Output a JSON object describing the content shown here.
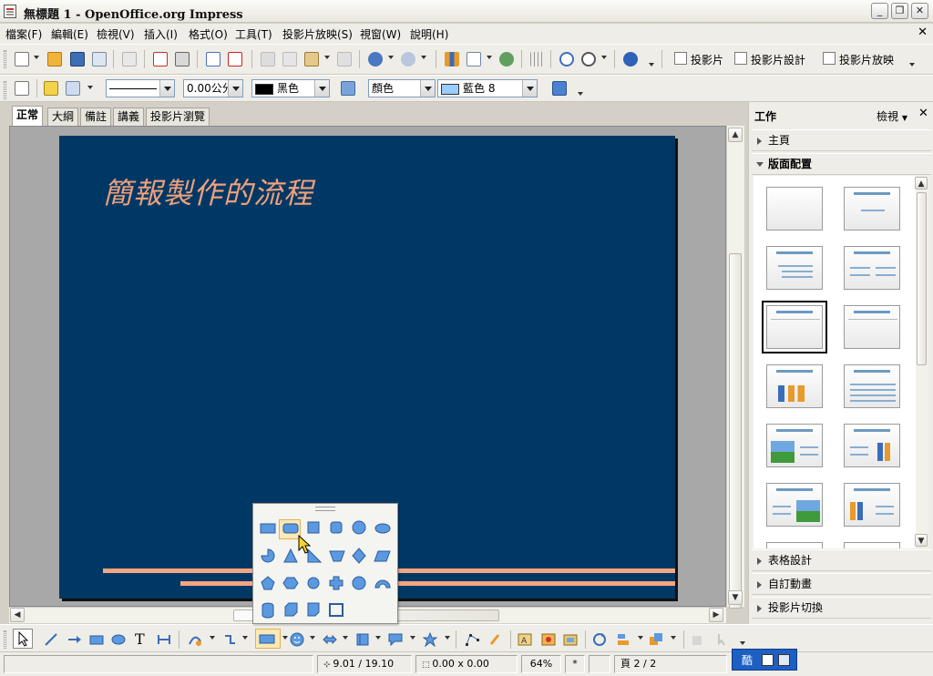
{
  "window": {
    "title": "無標題 1 - OpenOffice.org Impress",
    "minimize": "_",
    "maximize": "❐",
    "close": "✕"
  },
  "menu": {
    "items": [
      "檔案(F)",
      "編輯(E)",
      "檢視(V)",
      "插入(I)",
      "格式(O)",
      "工具(T)",
      "投影片放映(S)",
      "視窗(W)",
      "說明(H)"
    ],
    "close_doc": "✕"
  },
  "toolbar": {
    "slide": "投影片",
    "slide_design": "投影片設計",
    "slideshow": "投影片放映"
  },
  "line_fill": {
    "line_width": "0.00公分",
    "line_color": "黑色",
    "line_color_hex": "#000000",
    "area_style": "顏色",
    "area_color": "藍色 8",
    "area_color_hex": "#99ccff"
  },
  "view_tabs": [
    "正常",
    "大綱",
    "備註",
    "講義",
    "投影片瀏覽"
  ],
  "slide": {
    "title": "簡報製作的流程",
    "background": "#003865",
    "accent": "#f5a582"
  },
  "task_pane": {
    "title": "工作",
    "view_label": "檢視",
    "close": "✕",
    "sections": {
      "master": "主頁",
      "layouts": "版面配置",
      "table_design": "表格設計",
      "custom_animation": "自訂動畫",
      "slide_transition": "投影片切換"
    }
  },
  "status": {
    "position": "9.01 / 19.10",
    "size": "0.00 x 0.00",
    "zoom": "64%",
    "modified": "*",
    "page": "頁 2 / 2"
  },
  "ime": {
    "label": "酷"
  }
}
